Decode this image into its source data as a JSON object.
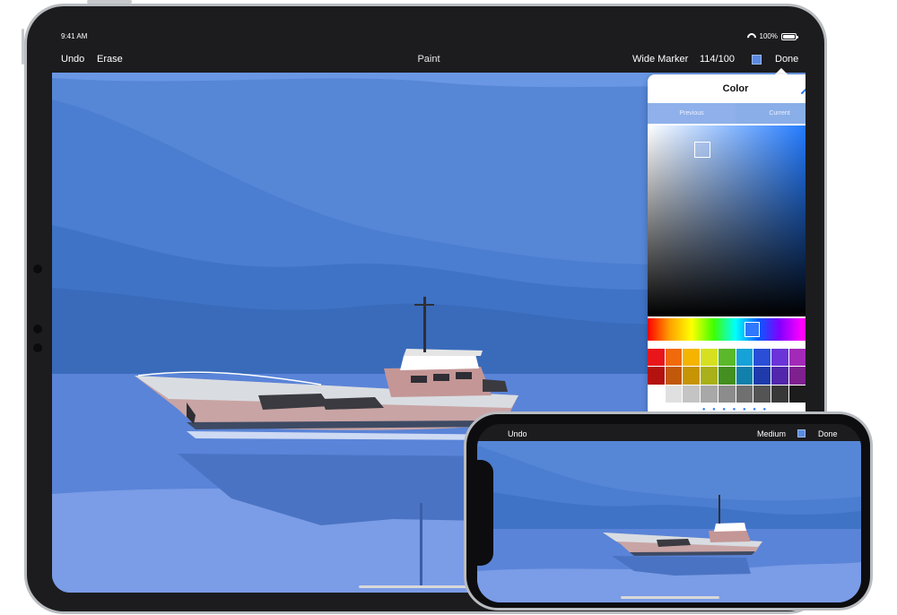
{
  "ipad": {
    "status": {
      "time": "9:41 AM",
      "battery": "100%"
    },
    "toolbar": {
      "undo": "Undo",
      "erase": "Erase",
      "title": "Paint",
      "tool": "Wide Marker",
      "count": "114/100",
      "done": "Done"
    },
    "color_popover": {
      "title": "Color",
      "previous_label": "Previous",
      "current_label": "Current",
      "page_dots": "● ● ● ● ● ● ●",
      "palette": [
        "#e8161b",
        "#f06a0c",
        "#f4b400",
        "#d6e021",
        "#5ab82a",
        "#16a2d8",
        "#2a4fd6",
        "#6b34d8",
        "#a32ab8",
        "#d81a6c",
        "#b3120f",
        "#c2580a",
        "#c79405",
        "#a9b019",
        "#438f1f",
        "#1180aa",
        "#1f3bab",
        "#5227ab",
        "#7f208f",
        "#a91454",
        "#ffffff",
        "#e0e0e0",
        "#c4c4c4",
        "#a8a8a8",
        "#8c8c8c",
        "#707070",
        "#545454",
        "#383838",
        "#1c1c1c",
        "#000000"
      ]
    },
    "selected_color": "#5b8ae0"
  },
  "iphone": {
    "toolbar": {
      "undo": "Undo",
      "tool": "Medium",
      "done": "Done"
    }
  }
}
